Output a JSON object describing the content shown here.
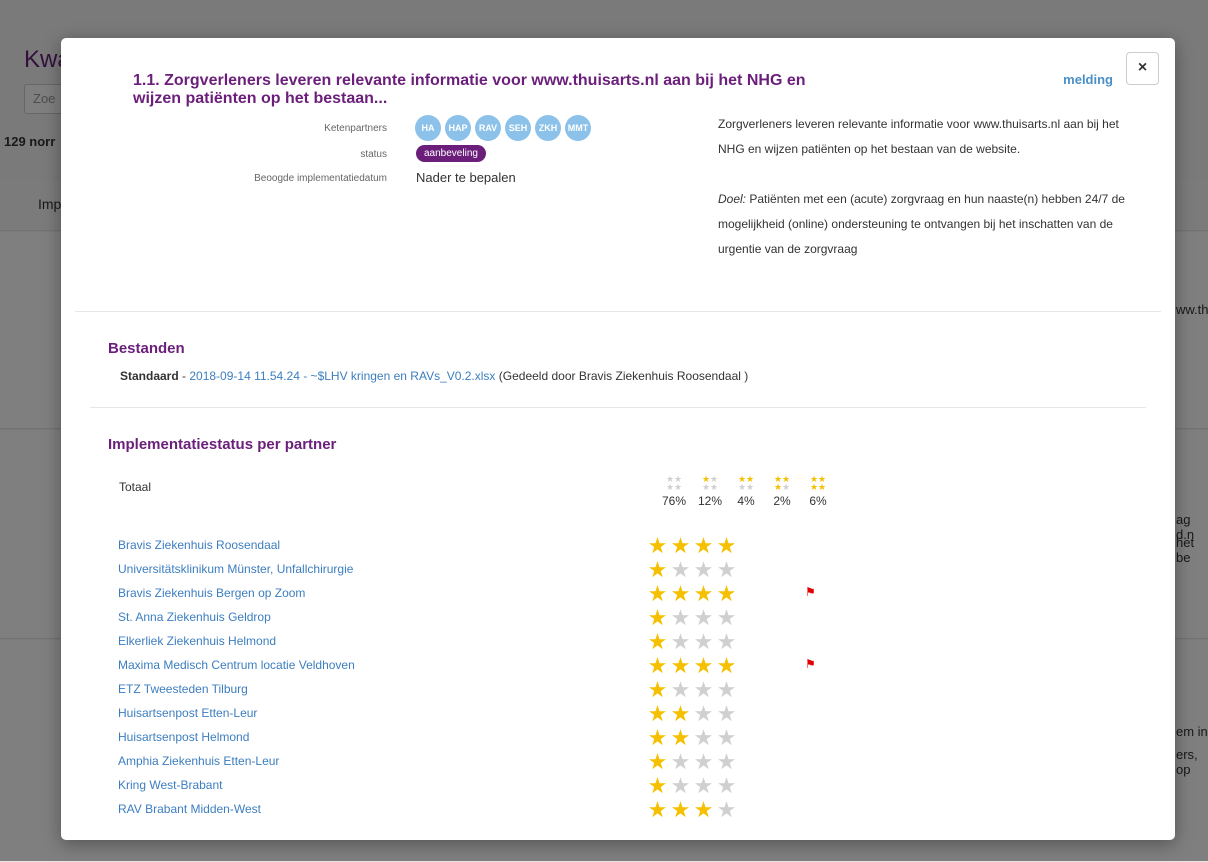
{
  "background": {
    "title_fragment": "Kwa",
    "search_placeholder_fragment": "Zoe",
    "count_fragment": "129 norr",
    "tab_fragment": "Imp",
    "right_fragments": [
      "ww.thu",
      "ag d.n",
      "het be",
      "em in",
      "ers, op"
    ]
  },
  "modal": {
    "close_label": "×",
    "melding_label": "melding",
    "title": "1.1. Zorgverleners leveren relevante informatie voor www.thuisarts.nl aan bij het NHG en wijzen patiënten op het bestaan...",
    "meta": {
      "ketenpartners_label": "Ketenpartners",
      "chips": [
        "HA",
        "HAP",
        "RAV",
        "SEH",
        "ZKH",
        "MMT"
      ],
      "status_label": "status",
      "status_value": "aanbeveling",
      "date_label": "Beoogde implementatiedatum",
      "date_value": "Nader te bepalen"
    },
    "description": {
      "text": "Zorgverleners leveren relevante informatie voor www.thuisarts.nl aan bij het NHG en wijzen patiënten op het bestaan van de website.",
      "goal_label": "Doel:",
      "goal_text": " Patiënten met een (acute) zorgvraag en hun naaste(n) hebben 24/7 de mogelijkheid (online) ondersteuning te ontvangen bij het inschatten van de urgentie van de zorgvraag"
    },
    "files": {
      "section_title": "Bestanden",
      "type_label": "Standaard",
      "separator": " - ",
      "file_link": "2018-09-14 11.54.24 - ~$LHV kringen en RAVs_V0.2.xlsx",
      "shared_by": " (Gedeeld door Bravis Ziekenhuis Roosendaal )"
    },
    "implementation": {
      "section_title": "Implementatiestatus per partner",
      "total_label": "Totaal",
      "summary": [
        {
          "filled": 0,
          "pct": "76%"
        },
        {
          "filled": 1,
          "pct": "12%"
        },
        {
          "filled": 2,
          "pct": "4%"
        },
        {
          "filled": 3,
          "pct": "2%"
        },
        {
          "filled": 4,
          "pct": "6%"
        }
      ],
      "partners": [
        {
          "name": "Bravis Ziekenhuis Roosendaal",
          "stars": 4,
          "flag": false
        },
        {
          "name": "Universitätsklinikum Münster, Unfallchirurgie",
          "stars": 1,
          "flag": false
        },
        {
          "name": "Bravis Ziekenhuis Bergen op Zoom",
          "stars": 4,
          "flag": true
        },
        {
          "name": "St. Anna Ziekenhuis Geldrop",
          "stars": 1,
          "flag": false
        },
        {
          "name": "Elkerliek Ziekenhuis Helmond",
          "stars": 1,
          "flag": false
        },
        {
          "name": "Maxima Medisch Centrum locatie Veldhoven",
          "stars": 4,
          "flag": true
        },
        {
          "name": "ETZ Tweesteden Tilburg",
          "stars": 1,
          "flag": false
        },
        {
          "name": "Huisartsenpost Etten-Leur",
          "stars": 2,
          "flag": false
        },
        {
          "name": "Huisartsenpost Helmond",
          "stars": 2,
          "flag": false
        },
        {
          "name": "Amphia Ziekenhuis Etten-Leur",
          "stars": 1,
          "flag": false
        },
        {
          "name": "Kring West-Brabant",
          "stars": 1,
          "flag": false
        },
        {
          "name": "RAV Brabant Midden-West",
          "stars": 3,
          "flag": false
        }
      ]
    }
  },
  "colors": {
    "brand": "#6b1f7b",
    "link": "#3c7ebf",
    "chip": "#8cc2ea",
    "star_filled": "#f5c000",
    "star_empty": "#d0d0d0",
    "flag": "#e00000"
  }
}
